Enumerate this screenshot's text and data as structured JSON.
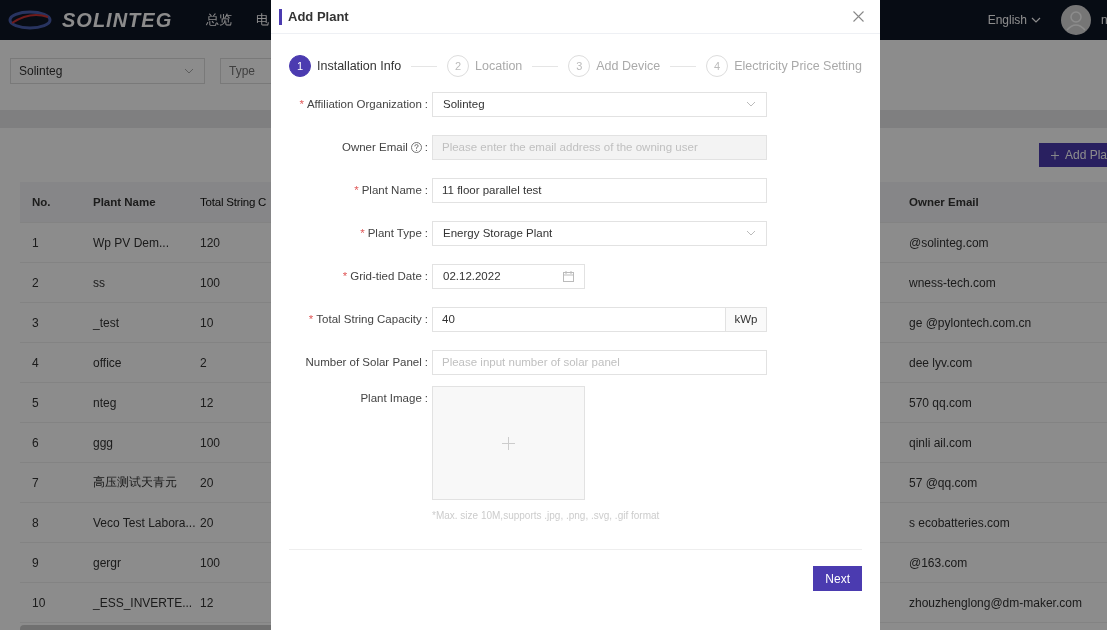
{
  "nav": {
    "logo": "SOLINTEG",
    "items": [
      "总览",
      "电"
    ],
    "language": "English",
    "user": "n"
  },
  "filters": {
    "organization": "Solinteg",
    "type_placeholder": "Type"
  },
  "add_button": "Add Pla",
  "table": {
    "columns": [
      "No.",
      "Plant Name",
      "Total String C",
      "Owner Email"
    ],
    "rows": [
      {
        "no": "1",
        "name": "Wp PV Dem...",
        "capacity": "120",
        "email": "@solinteg.com"
      },
      {
        "no": "2",
        "name": "ss",
        "capacity": "100",
        "email": "wness-tech.com"
      },
      {
        "no": "3",
        "name": "_test",
        "capacity": "10",
        "email": "ge        @pylontech.com.cn"
      },
      {
        "no": "4",
        "name": "office",
        "capacity": "2",
        "email": "dee        lyv.com"
      },
      {
        "no": "5",
        "name": "nteg",
        "capacity": "12",
        "email": "570        qq.com"
      },
      {
        "no": "6",
        "name": "ggg",
        "capacity": "100",
        "email": "qinli        ail.com"
      },
      {
        "no": "7",
        "name": "高压测试天青元",
        "capacity": "20",
        "email": "57        @qq.com"
      },
      {
        "no": "8",
        "name": "Veco Test Labora...",
        "capacity": "20",
        "email": "s        ecobatteries.com"
      },
      {
        "no": "9",
        "name": "gergr",
        "capacity": "100",
        "email": "@163.com"
      },
      {
        "no": "10",
        "name": "_ESS_INVERTE...",
        "capacity": "12",
        "email": "zhouzhenglong@dm-maker.com"
      }
    ]
  },
  "modal": {
    "title": "Add Plant",
    "steps": [
      {
        "number": "1",
        "label": "Installation Info",
        "selected": true
      },
      {
        "number": "2",
        "label": "Location",
        "selected": false
      },
      {
        "number": "3",
        "label": "Add Device",
        "selected": false
      },
      {
        "number": "4",
        "label": "Electricity Price Setting",
        "selected": false
      }
    ],
    "fields": [
      {
        "kind": "select",
        "required_mark": "*",
        "label": "Affiliation Organization",
        "colon": ":",
        "value": "Solinteg"
      },
      {
        "kind": "input",
        "label": "Owner Email",
        "help": true,
        "colon": ":",
        "disabled": true,
        "placeholder": "Please enter the email address of the owning user"
      },
      {
        "kind": "input",
        "required_mark": "*",
        "label": "Plant Name",
        "colon": ":",
        "disabled": false,
        "value": "11 floor parallel test"
      },
      {
        "kind": "select",
        "required_mark": "*",
        "label": "Plant Type",
        "colon": ":",
        "value": "Energy Storage Plant"
      },
      {
        "kind": "date",
        "required_mark": "*",
        "label": "Grid-tied Date",
        "colon": ":",
        "value": "02.12.2022"
      },
      {
        "kind": "suffix",
        "required_mark": "*",
        "label": "Total String Capacity",
        "colon": ":",
        "value": "40",
        "suffix": "kWp"
      },
      {
        "kind": "input",
        "label": "Number of Solar Panel",
        "colon": ":",
        "disabled": false,
        "placeholder": "Please input number of solar panel"
      },
      {
        "kind": "upload",
        "label": "Plant Image",
        "colon": ":",
        "hint": "*Max. size 10M,supports .jpg, .png, .svg, .gif format"
      }
    ],
    "next_button": "Next"
  }
}
